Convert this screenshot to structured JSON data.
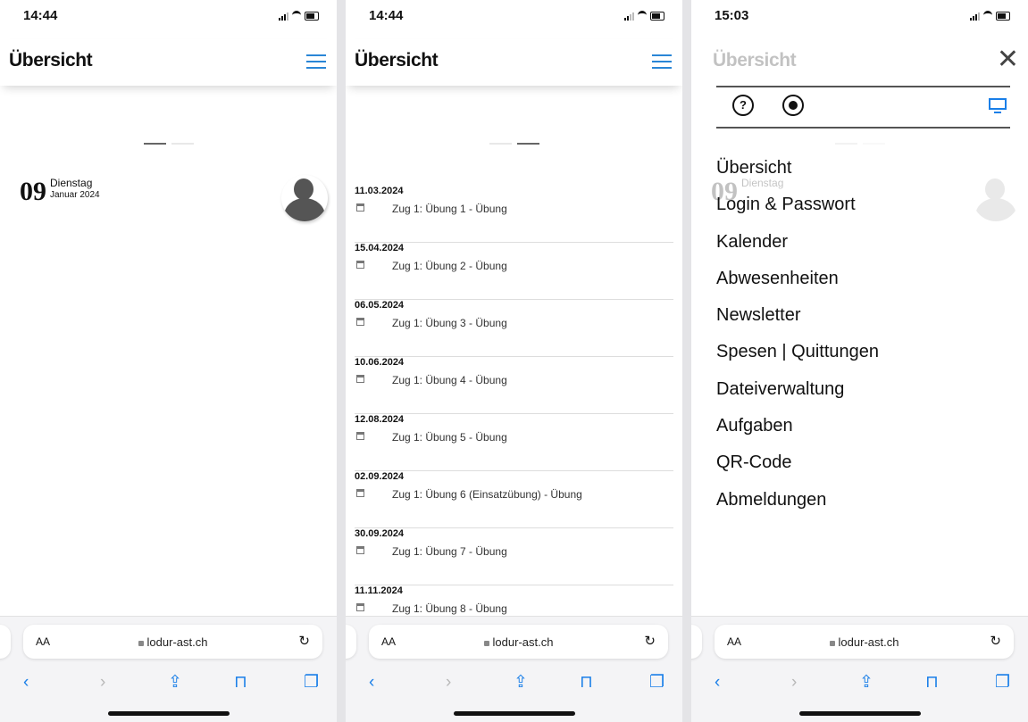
{
  "screens": [
    {
      "time": "14:44",
      "title": "Übersicht",
      "day": {
        "num": "09",
        "weekday": "Dienstag",
        "month": "Januar 2024"
      },
      "url": "lodur-ast.ch",
      "aa": "AA"
    },
    {
      "time": "14:44",
      "title": "Übersicht",
      "events": [
        {
          "date": "11.03.2024",
          "title": "Zug 1: Übung 1 - Übung"
        },
        {
          "date": "15.04.2024",
          "title": "Zug 1: Übung 2 - Übung"
        },
        {
          "date": "06.05.2024",
          "title": "Zug 1: Übung 3 - Übung"
        },
        {
          "date": "10.06.2024",
          "title": "Zug 1: Übung 4 - Übung"
        },
        {
          "date": "12.08.2024",
          "title": "Zug 1: Übung 5 - Übung"
        },
        {
          "date": "02.09.2024",
          "title": "Zug 1: Übung 6 (Einsatzübung) - Übung"
        },
        {
          "date": "30.09.2024",
          "title": "Zug 1: Übung 7 - Übung"
        },
        {
          "date": "11.11.2024",
          "title": "Zug 1: Übung 8 - Übung"
        }
      ],
      "url": "lodur-ast.ch",
      "aa": "AA"
    },
    {
      "time": "15:03",
      "title": "Übersicht",
      "day": {
        "num": "09",
        "weekday": "Dienstag"
      },
      "help_icon": "?",
      "menu": [
        "Übersicht",
        "Login & Passwort",
        "Kalender",
        "Abwesenheiten",
        "Newsletter",
        "Spesen | Quittungen",
        "Dateiverwaltung",
        "Aufgaben",
        "QR-Code",
        "Abmeldungen"
      ],
      "url": "lodur-ast.ch",
      "aa": "AA"
    }
  ],
  "glyphs": {
    "reload": "↻",
    "back": "‹",
    "forward": "›",
    "share": "⇪",
    "bookmarks": "⊓",
    "tabs": "❐",
    "close": "✕"
  },
  "icons": [
    "signal-icon",
    "wifi-icon",
    "battery-icon",
    "hamburger-menu-icon",
    "calendar-icon",
    "lock-icon",
    "reload-icon",
    "back-icon",
    "forward-icon",
    "share-icon",
    "bookmarks-icon",
    "tabs-icon",
    "close-icon",
    "help-icon",
    "record-icon",
    "desktop-icon"
  ],
  "colors": {
    "accent": "#2a86d6",
    "link": "#1a7fe8",
    "disabled": "#b8b8b8"
  }
}
